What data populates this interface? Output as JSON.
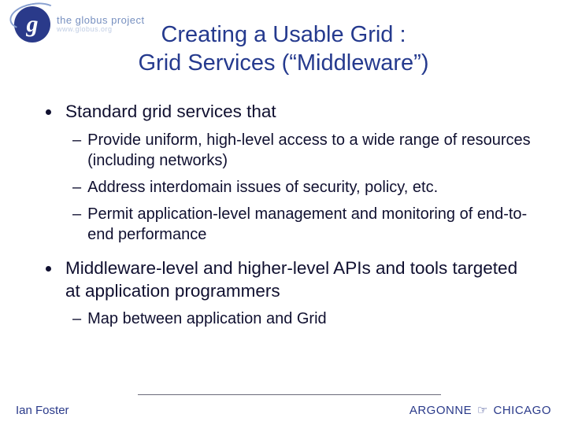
{
  "logo": {
    "glyph": "g",
    "line1": "the globus project",
    "line2": "www.globus.org"
  },
  "title": {
    "line1": "Creating a Usable Grid :",
    "line2": "Grid Services (“Middleware”)"
  },
  "bullets": [
    {
      "text": "Standard grid services that",
      "sub": [
        "Provide uniform, high-level access to a wide range of resources (including networks)",
        "Address interdomain issues of security, policy, etc.",
        "Permit application-level management and monitoring of end-to-end performance"
      ]
    },
    {
      "text": "Middleware-level and higher-level APIs and tools targeted at application programmers",
      "sub": [
        "Map between application and Grid"
      ]
    }
  ],
  "footer": {
    "left": "Ian Foster",
    "right_a": "ARGONNE",
    "right_hand": "☞",
    "right_b": "CHICAGO"
  }
}
